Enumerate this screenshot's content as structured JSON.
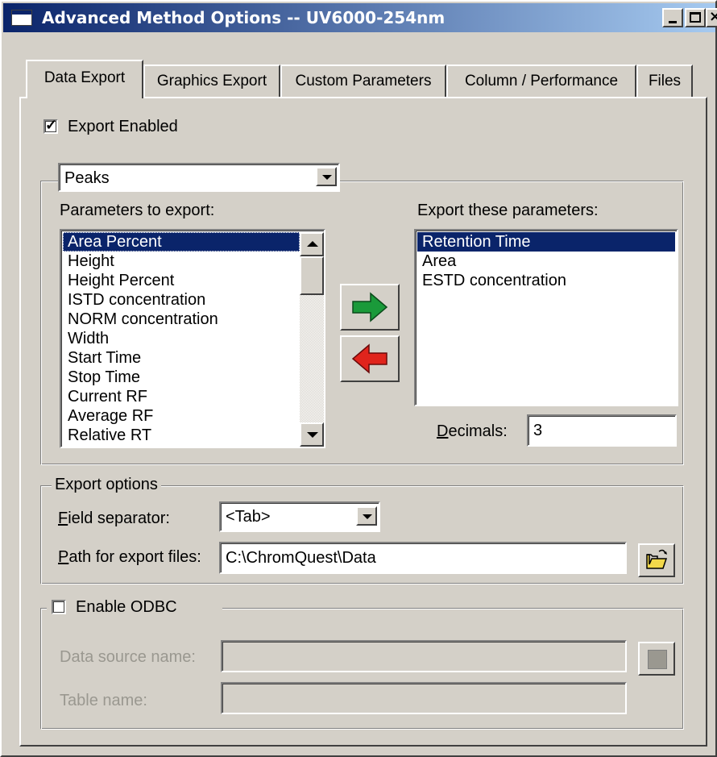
{
  "window": {
    "title": "Advanced Method Options -- UV6000-254nm"
  },
  "tabs": [
    {
      "label": "Data Export",
      "active": true
    },
    {
      "label": "Graphics Export",
      "active": false
    },
    {
      "label": "Custom Parameters",
      "active": false
    },
    {
      "label": "Column / Performance",
      "active": false
    },
    {
      "label": "Files",
      "active": false
    }
  ],
  "export_enabled": {
    "label": "Export Enabled",
    "checked": true
  },
  "category": {
    "selected": "Peaks"
  },
  "params_available": {
    "label": "Parameters to export:",
    "items": [
      "Area Percent",
      "Height",
      "Height Percent",
      "ISTD concentration",
      "NORM concentration",
      "Width",
      "Start Time",
      "Stop Time",
      "Current RF",
      "Average RF",
      "Relative RT"
    ],
    "selected_index": 0
  },
  "params_export": {
    "label": "Export these parameters:",
    "items": [
      "Retention Time",
      "Area",
      "ESTD concentration"
    ],
    "selected_index": 0
  },
  "buttons": {
    "add_icon": "green-right-arrow-icon",
    "remove_icon": "red-left-arrow-icon",
    "browse_icon": "open-folder-icon"
  },
  "decimals": {
    "label_pre": "",
    "label_ul": "D",
    "label_post": "ecimals:",
    "value": "3"
  },
  "export_options": {
    "title": "Export options",
    "field_sep_ul": "F",
    "field_sep_rest": "ield separator:",
    "field_sep_value": "<Tab>",
    "path_ul": "P",
    "path_rest": "ath for export files:",
    "path_value": "C:\\ChromQuest\\Data"
  },
  "odbc": {
    "label": "Enable ODBC",
    "checked": false,
    "data_source_label": "Data source name:",
    "data_source_value": "",
    "table_label": "Table name:",
    "table_value": ""
  },
  "colors": {
    "selection": "#0a246a",
    "face": "#d4d0c8",
    "add_arrow": "#1a9a3a",
    "remove_arrow": "#e0241c"
  }
}
